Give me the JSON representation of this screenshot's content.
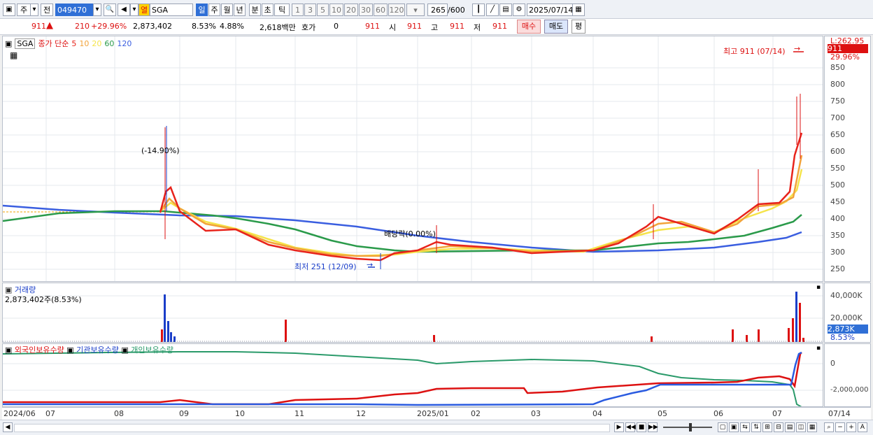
{
  "toolbar": {
    "market": "주",
    "prev": "전",
    "code": "049470",
    "name_tag": "열",
    "name": "SGA",
    "periods": [
      "일",
      "주",
      "월",
      "년",
      "분",
      "초",
      "틱"
    ],
    "intervals": [
      "1",
      "3",
      "5",
      "10",
      "20",
      "30",
      "60",
      "120"
    ],
    "count": "265",
    "count_max": "/600",
    "date": "2025/07/14"
  },
  "quote": {
    "price": "911",
    "change": "210",
    "change_pct": "+29.96%",
    "volume": "2,873,402",
    "turnover_pct": "8.53%",
    "other_pct": "4.88%",
    "amount": "2,618백만",
    "bid_label": "호가",
    "bid_val": "0",
    "price2": "911",
    "open_label": "시",
    "open": "911",
    "high_label": "고",
    "high": "911",
    "low_label": "저",
    "low": "911",
    "buy": "매수",
    "sell": "매도",
    "avg": "평"
  },
  "price_panel": {
    "name": "SGA",
    "legend_title": "종가 단순",
    "ma": [
      {
        "label": "5",
        "color": "#e8231b"
      },
      {
        "label": "10",
        "color": "#f2a33a"
      },
      {
        "label": "20",
        "color": "#f5e44a"
      },
      {
        "label": "60",
        "color": "#2a9a4a"
      },
      {
        "label": "120",
        "color": "#3a5ee0"
      }
    ],
    "high_note": "최고 911 (07/14)",
    "low_note": "최저 251 (12/09)",
    "drop_note": "(-14.90%)",
    "dividend_note": "배당락(0.00%)",
    "y_top": "L:262.95",
    "cur_price": "911",
    "cur_pct": "29.96%",
    "y_ticks": [
      "850",
      "800",
      "750",
      "700",
      "650",
      "600",
      "550",
      "500",
      "450",
      "400",
      "350",
      "300",
      "250"
    ]
  },
  "volume_panel": {
    "title": "거래량",
    "value": "2,873,402주(8.53%)",
    "y_ticks": [
      "40,000K",
      "20,000K"
    ],
    "cur": "2,873K",
    "cur_pct": "8.53%"
  },
  "holding_panel": {
    "legend": [
      "외국인보유수량",
      "기관보유수량",
      "개인보유수량"
    ],
    "legend_colors": [
      "#d11",
      "#2a5be0",
      "#2a9a6a"
    ],
    "y_ticks": [
      "0",
      "-2,000,000"
    ]
  },
  "x_axis": [
    "2024/06",
    "07",
    "08",
    "09",
    "10",
    "11",
    "12",
    "2025/01",
    "02",
    "03",
    "04",
    "05",
    "06",
    "07",
    "07/14"
  ]
}
